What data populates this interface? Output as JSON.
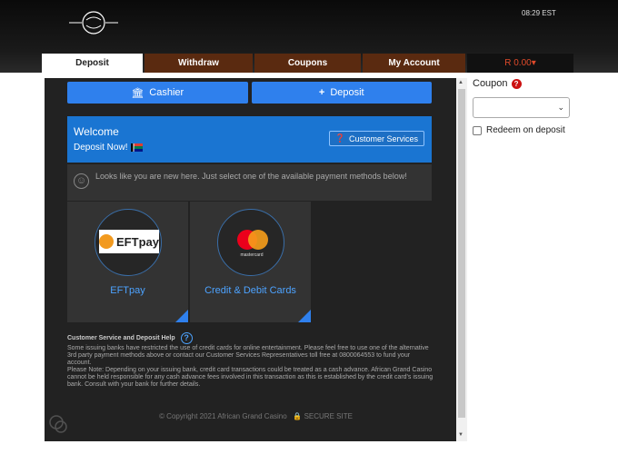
{
  "header": {
    "time": "08:29 EST",
    "tabs": [
      {
        "label": "Deposit"
      },
      {
        "label": "Withdraw"
      },
      {
        "label": "Coupons"
      },
      {
        "label": "My Account"
      }
    ],
    "balance": "R 0.00"
  },
  "cashier": {
    "cashier_label": "Cashier",
    "deposit_label": "Deposit",
    "welcome_title": "Welcome",
    "welcome_sub": "Deposit Now!",
    "customer_services": "Customer Services",
    "notice": "Looks like you are new here. Just select one of the available payment methods below!",
    "methods": [
      {
        "label": "EFTpay",
        "logo_text": "EFTpay"
      },
      {
        "label": "Credit & Debit Cards",
        "logo_text": "mastercard"
      }
    ],
    "help_title": "Customer Service and Deposit Help",
    "help_body": "Some issuing banks have restricted the use of credit cards for online entertainment. Please feel free to use one of the alternative 3rd party payment methods above or contact our Customer Services Representatives toll free at 0800064553 to fund your account.",
    "help_note": "Please Note: Depending on your issuing bank, credit card transactions could be treated as a cash advance. African Grand Casino cannot be held responsible for any cash advance fees involved in this transaction as this is established by the credit card's issuing bank. Consult with your bank for further details.",
    "copyright": "© Copyright 2021 African Grand Casino",
    "secure": "SECURE SITE"
  },
  "coupon": {
    "title": "Coupon",
    "redeem_label": "Redeem on deposit"
  }
}
